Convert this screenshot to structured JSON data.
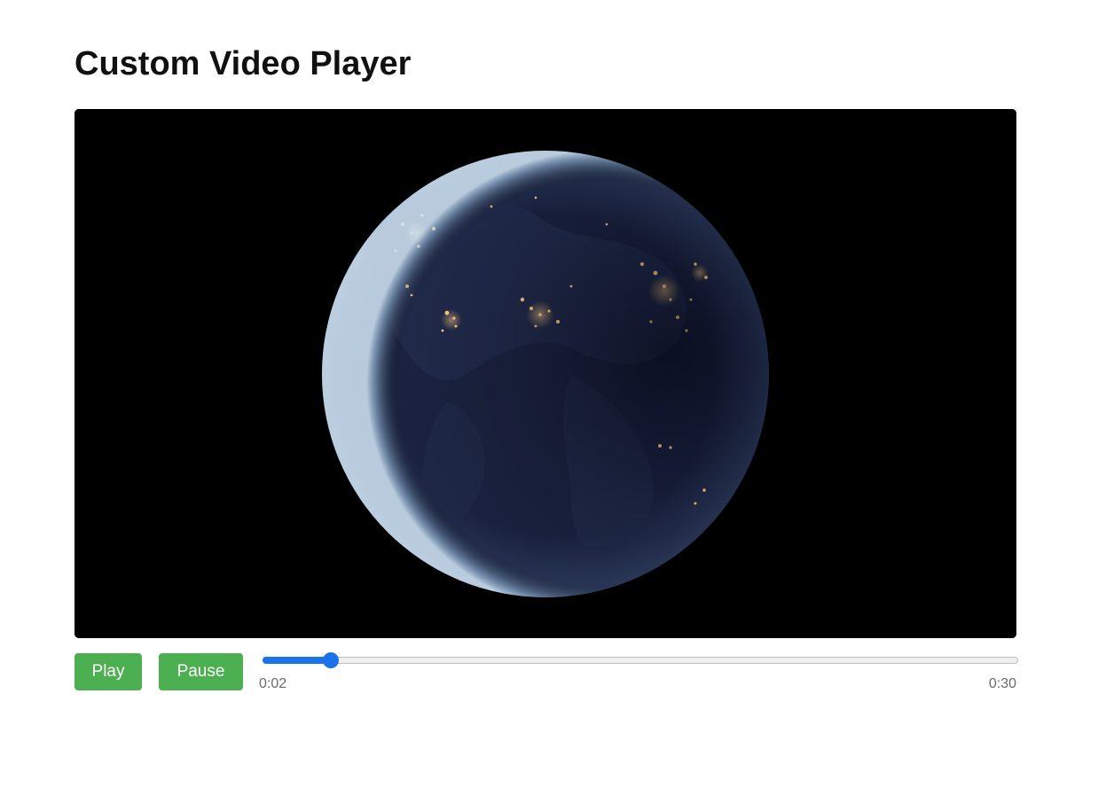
{
  "page": {
    "title": "Custom Video Player"
  },
  "video": {
    "content": "earth-at-night-globe"
  },
  "controls": {
    "play_label": "Play",
    "pause_label": "Pause",
    "current_time": "0:02",
    "duration": "0:30",
    "progress_fraction": 0.0905
  },
  "colors": {
    "button_bg": "#4caf50",
    "seek_accent": "#1a73e8",
    "video_bg": "#000000"
  },
  "icons": {
    "seek_thumb": "slider-thumb-icon"
  }
}
